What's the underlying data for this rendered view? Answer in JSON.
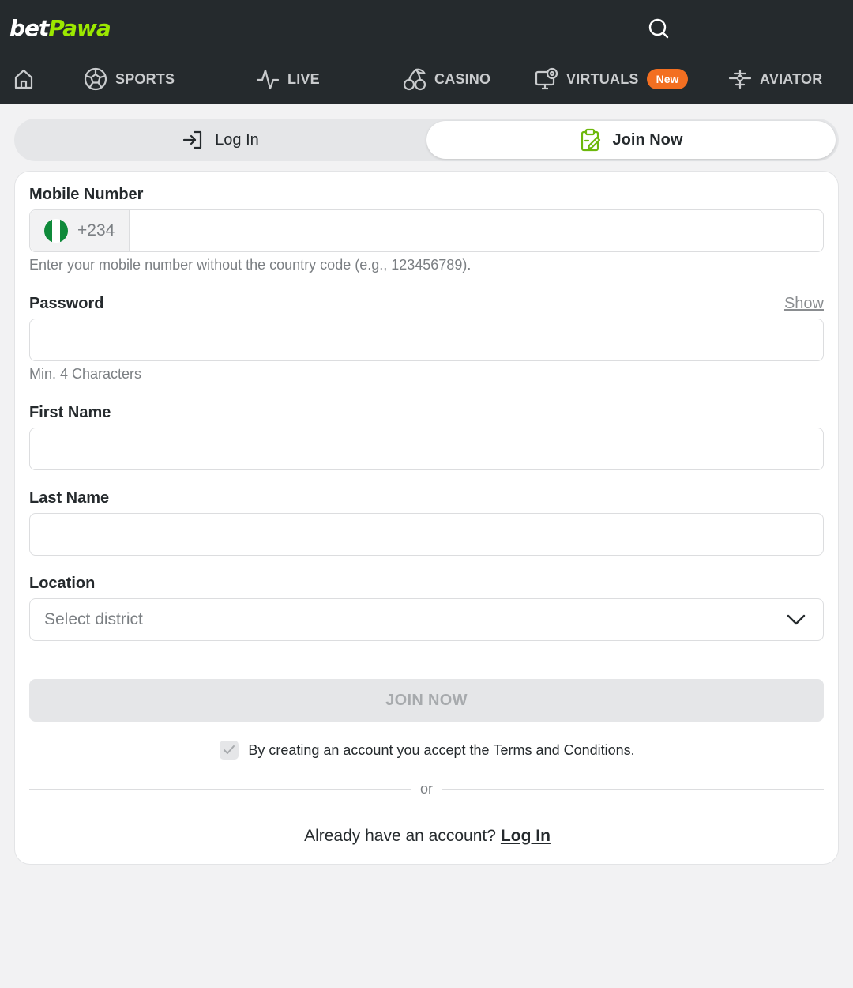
{
  "header": {
    "logo": {
      "part1": "bet",
      "part2": "Pawa"
    },
    "search_icon": "search-icon"
  },
  "nav": {
    "items": [
      {
        "icon": "home-icon",
        "label": ""
      },
      {
        "icon": "soccer-ball-icon",
        "label": "SPORTS"
      },
      {
        "icon": "pulse-icon",
        "label": "LIVE"
      },
      {
        "icon": "cherries-icon",
        "label": "CASINO"
      },
      {
        "icon": "monitor-ball-icon",
        "label": "VIRTUALS",
        "badge": "New"
      },
      {
        "icon": "plane-icon",
        "label": "AVIATOR"
      }
    ]
  },
  "tabs": {
    "login_label": "Log In",
    "join_label": "Join Now",
    "active": "join"
  },
  "form": {
    "mobile": {
      "label": "Mobile Number",
      "country_code": "+234",
      "value": "",
      "hint": "Enter your mobile number without the country code (e.g., 123456789)."
    },
    "password": {
      "label": "Password",
      "show_label": "Show",
      "value": "",
      "hint": "Min. 4 Characters"
    },
    "first_name": {
      "label": "First Name",
      "value": ""
    },
    "last_name": {
      "label": "Last Name",
      "value": ""
    },
    "location": {
      "label": "Location",
      "placeholder": "Select district"
    },
    "submit_label": "JOIN NOW",
    "terms": {
      "text": "By creating an account you accept the",
      "link": "Terms and Conditions.",
      "checked": true
    },
    "divider_text": "or",
    "already": {
      "text": "Already have an account?",
      "link": "Log In"
    }
  },
  "colors": {
    "topbar": "#252a2d",
    "brand_green": "#9ce800",
    "badge_orange": "#f36f21",
    "page_bg": "#f2f2f3"
  }
}
